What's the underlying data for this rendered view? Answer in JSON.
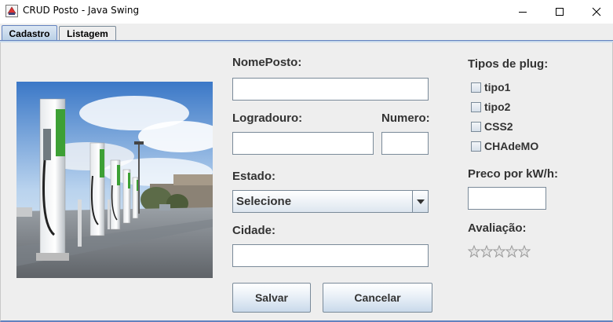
{
  "window": {
    "title": "CRUD Posto - Java Swing",
    "controls": [
      "minimize-icon",
      "maximize-icon",
      "close-icon"
    ]
  },
  "tabs": [
    {
      "label": "Cadastro",
      "selected": true
    },
    {
      "label": "Listagem",
      "selected": false
    }
  ],
  "form": {
    "nome_label": "NomePosto:",
    "nome_value": "",
    "logradouro_label": "Logradouro:",
    "logradouro_value": "",
    "numero_label": "Numero:",
    "numero_value": "",
    "estado_label": "Estado:",
    "estado_selected": "Selecione",
    "cidade_label": "Cidade:",
    "cidade_value": ""
  },
  "plugs": {
    "label": "Tipos de plug:",
    "options": [
      {
        "label": "tipo1",
        "checked": false
      },
      {
        "label": "tipo2",
        "checked": false
      },
      {
        "label": "CSS2",
        "checked": false
      },
      {
        "label": "CHAdeMO",
        "checked": false
      }
    ]
  },
  "preco": {
    "label": "Preco por kW/h:",
    "value": ""
  },
  "avaliacao": {
    "label": "Avaliação:",
    "max_stars": 5,
    "rating": 0
  },
  "buttons": {
    "salvar": "Salvar",
    "cancelar": "Cancelar"
  },
  "colors": {
    "panel_bg": "#eeeeee",
    "accent": "#6382bf",
    "label_text": "#333333"
  }
}
